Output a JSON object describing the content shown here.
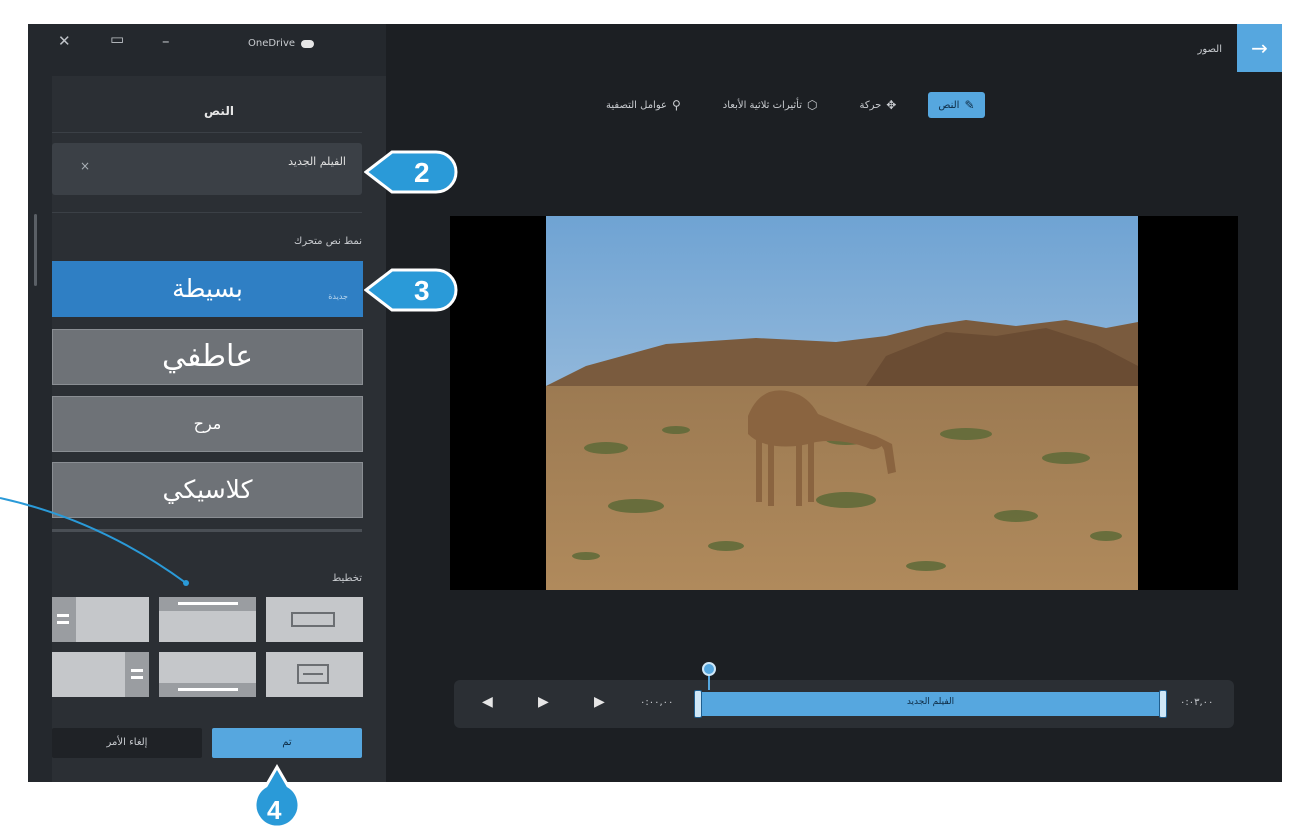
{
  "window": {
    "app_name": "OneDrive",
    "back_arrow": "→",
    "page_title": "الصور"
  },
  "sidebar": {
    "title": "النص",
    "text_field_value": "الفيلم الجديد",
    "clear_icon": "×",
    "styles_label": "نمط نص متحرك",
    "new_badge": "جديدة",
    "styles": [
      {
        "name": "بسيطة",
        "selected": true
      },
      {
        "name": "عاطفي",
        "selected": false
      },
      {
        "name": "مرح",
        "selected": false
      },
      {
        "name": "كلاسيكي",
        "selected": false
      }
    ],
    "layout_label": "تخطيط",
    "cancel_label": "إلغاء الأمر",
    "done_label": "تم"
  },
  "toolbar": {
    "items": [
      {
        "label": "عوامل التصفية",
        "icon": "filter-icon"
      },
      {
        "label": "تأثيرات ثلاثية الأبعاد",
        "icon": "3d-effects-icon"
      },
      {
        "label": "حركة",
        "icon": "motion-icon"
      },
      {
        "label": "النص",
        "icon": "text-icon",
        "active": true
      }
    ]
  },
  "timeline": {
    "start_time": "٠:٠٠,٠٠",
    "end_time": "٠:٠٣,٠٠",
    "clip_label": "الفيلم الجديد"
  },
  "callouts": [
    "2",
    "3",
    "4"
  ],
  "colors": {
    "accent": "#56a7df",
    "callout": "#2a9ad8",
    "selected_style": "#2f7fc4"
  }
}
